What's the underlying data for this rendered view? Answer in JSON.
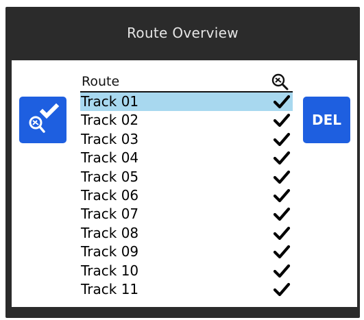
{
  "title": "Route Overview",
  "colors": {
    "accent": "#1e5fe0",
    "selected_row": "#a8d8ef",
    "frame": "#2b2b2b"
  },
  "buttons": {
    "confirm_icon": "search-check-icon",
    "delete_label": "DEL"
  },
  "table": {
    "header": {
      "route": "Route",
      "status_icon": "search-icon"
    },
    "selected_index": 0,
    "rows": [
      {
        "name": "Track 01",
        "checked": true
      },
      {
        "name": "Track 02",
        "checked": true
      },
      {
        "name": "Track 03",
        "checked": true
      },
      {
        "name": "Track 04",
        "checked": true
      },
      {
        "name": "Track 05",
        "checked": true
      },
      {
        "name": "Track 06",
        "checked": true
      },
      {
        "name": "Track 07",
        "checked": true
      },
      {
        "name": "Track 08",
        "checked": true
      },
      {
        "name": "Track 09",
        "checked": true
      },
      {
        "name": "Track 10",
        "checked": true
      },
      {
        "name": "Track 11",
        "checked": true
      }
    ]
  }
}
